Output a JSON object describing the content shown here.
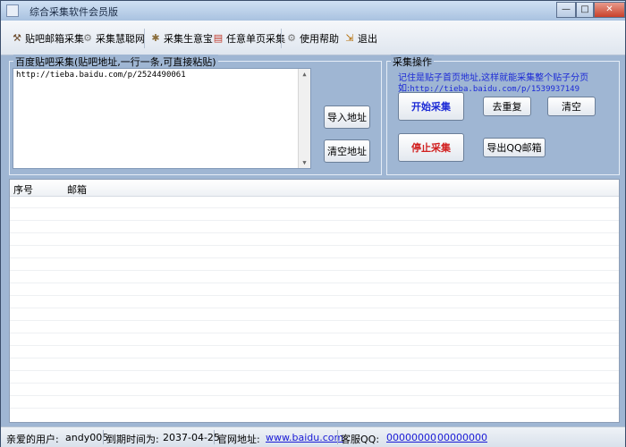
{
  "window": {
    "title": "综合采集软件会员版",
    "min_label": "—",
    "max_label": "□",
    "close_label": "✕"
  },
  "toolbar": {
    "items": [
      {
        "label": "贴吧邮箱采集",
        "icon": "hammer-icon"
      },
      {
        "label": "采集慧聪网",
        "icon": "gear-icon"
      },
      {
        "label": "采集生意宝",
        "icon": "tools-icon"
      },
      {
        "label": "任意单页采集",
        "icon": "flag-icon"
      },
      {
        "label": "使用帮助",
        "icon": "gear-icon"
      },
      {
        "label": "退出",
        "icon": "exit-icon"
      }
    ]
  },
  "left_group": {
    "label": "百度贴吧采集(贴吧地址,一行一条,可直接粘贴)",
    "textarea_value": "http://tieba.baidu.com/p/2524490061",
    "import_button": "导入地址",
    "clear_button": "清空地址"
  },
  "right_group": {
    "label": "采集操作",
    "hint_line1": "记住是贴子首页地址,这样就能采集整个贴子分页",
    "hint_line2_prefix": "如:",
    "hint_line2_url": "http://tieba.baidu.com/p/1539937149",
    "start_button": "开始采集",
    "dedupe_button": "去重复",
    "clear_button": "清空",
    "stop_button": "停止采集",
    "export_button": "导出QQ邮箱"
  },
  "list": {
    "columns": [
      "序号",
      "邮箱"
    ],
    "rows": []
  },
  "statusbar": {
    "user_label": "亲爱的用户:",
    "user_value": "andy005",
    "expire_label": "到期时间为:",
    "expire_value": "2037-04-25",
    "site_label": "官网地址:",
    "site_value": "www.baidu.com",
    "qq_label": "客服QQ:",
    "qq1": "00000000",
    "qq2": "00000000"
  },
  "colors": {
    "accent_red": "#d11f1f",
    "accent_blue": "#1d2bd6",
    "link": "#1a1ad6"
  }
}
